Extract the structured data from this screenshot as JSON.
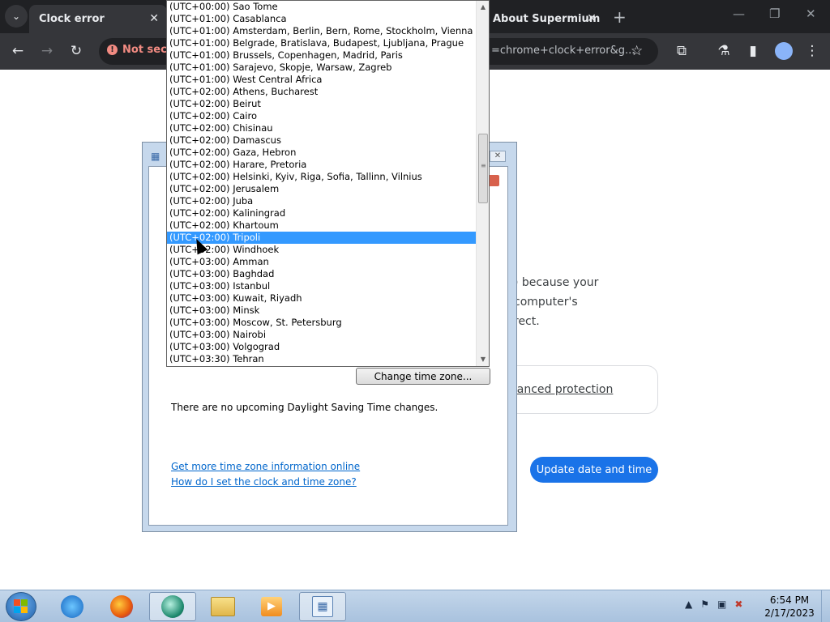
{
  "browser": {
    "active_tab_title": "Clock error",
    "right_tab_title": "About Supermium",
    "security_label": "Not secure",
    "url_visible_tail": "=chrome+clock+error&g..."
  },
  "page": {
    "error_text_line1": ") because your computer's",
    "error_text_line2": "rect.",
    "protection_link": "nhanced protection",
    "update_button": "Update date and time"
  },
  "dialog": {
    "change_tz_button": "Change time zone...",
    "dst_text": "There are no upcoming Daylight Saving Time changes.",
    "link_more_info": "Get more time zone information online",
    "link_how_to": "How do I set the clock and time zone?"
  },
  "timezones": [
    "(UTC+00:00) Sao Tome",
    "(UTC+01:00) Casablanca",
    "(UTC+01:00) Amsterdam, Berlin, Bern, Rome, Stockholm, Vienna",
    "(UTC+01:00) Belgrade, Bratislava, Budapest, Ljubljana, Prague",
    "(UTC+01:00) Brussels, Copenhagen, Madrid, Paris",
    "(UTC+01:00) Sarajevo, Skopje, Warsaw, Zagreb",
    "(UTC+01:00) West Central Africa",
    "(UTC+02:00) Athens, Bucharest",
    "(UTC+02:00) Beirut",
    "(UTC+02:00) Cairo",
    "(UTC+02:00) Chisinau",
    "(UTC+02:00) Damascus",
    "(UTC+02:00) Gaza, Hebron",
    "(UTC+02:00) Harare, Pretoria",
    "(UTC+02:00) Helsinki, Kyiv, Riga, Sofia, Tallinn, Vilnius",
    "(UTC+02:00) Jerusalem",
    "(UTC+02:00) Juba",
    "(UTC+02:00) Kaliningrad",
    "(UTC+02:00) Khartoum",
    "(UTC+02:00) Tripoli",
    "(UTC+02:00) Windhoek",
    "(UTC+03:00) Amman",
    "(UTC+03:00) Baghdad",
    "(UTC+03:00) Istanbul",
    "(UTC+03:00) Kuwait, Riyadh",
    "(UTC+03:00) Minsk",
    "(UTC+03:00) Moscow, St. Petersburg",
    "(UTC+03:00) Nairobi",
    "(UTC+03:00) Volgograd",
    "(UTC+03:30) Tehran"
  ],
  "selected_timezone": "(UTC+02:00) Tripoli",
  "taskbar": {
    "time": "6:54 PM",
    "date": "2/17/2023",
    "apps": [
      "internet-explorer-icon",
      "firefox-icon",
      "supermium-icon",
      "file-explorer-icon",
      "media-player-icon",
      "date-time-icon"
    ]
  },
  "colors": {
    "selection": "#3399ff",
    "link": "#0066cc",
    "update_button": "#1a73e8",
    "not_secure": "#f28b82"
  }
}
